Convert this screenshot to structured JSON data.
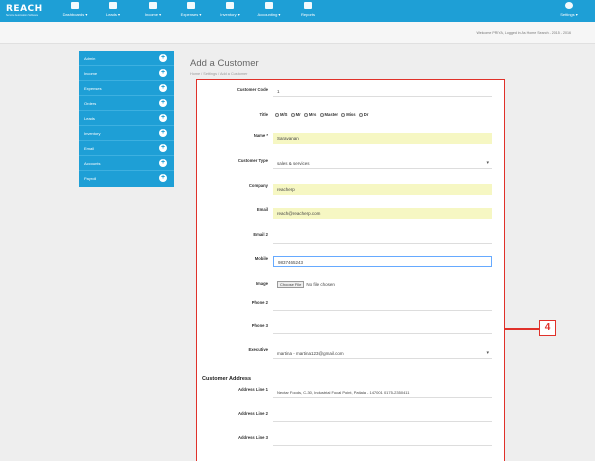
{
  "app": {
    "logo_text": "REACH",
    "logo_sub": "Service Automation Software"
  },
  "nav": {
    "items": [
      {
        "label": "Dashboards ▾",
        "icon": "home-icon"
      },
      {
        "label": "Leads ▾",
        "icon": "list-icon"
      },
      {
        "label": "Income ▾",
        "icon": "chart-icon"
      },
      {
        "label": "Expenses ▾",
        "icon": "money-icon"
      },
      {
        "label": "Inventory ▾",
        "icon": "boxes-icon"
      },
      {
        "label": "Accounting ▾",
        "icon": "book-icon"
      },
      {
        "label": "Reports",
        "icon": "report-icon"
      }
    ],
    "settings_label": "Settings ▾"
  },
  "subheader": {
    "welcome": "Welcome PRIYA, Logged in As Home Search - 2015 - 2016"
  },
  "sidebar": {
    "items": [
      {
        "label": "Admin"
      },
      {
        "label": "Income"
      },
      {
        "label": "Expenses"
      },
      {
        "label": "Orders"
      },
      {
        "label": "Leads"
      },
      {
        "label": "Inventory"
      },
      {
        "label": "Email"
      },
      {
        "label": "Accounts"
      },
      {
        "label": "Payroll"
      }
    ],
    "plus_symbol": "+"
  },
  "page": {
    "title": "Add a Customer",
    "breadcrumb": "Home  /  Settings  /  Add a Customer"
  },
  "form": {
    "customer_code": {
      "label": "Customer Code",
      "value": "1"
    },
    "title": {
      "label": "Title",
      "options": [
        "M/S",
        "Mr",
        "Mrs",
        "Master",
        "Miss",
        "Dr"
      ]
    },
    "name": {
      "label": "Name *",
      "value": "Saravanan"
    },
    "customer_type": {
      "label": "Customer Type",
      "value": "sales & services"
    },
    "company": {
      "label": "Company",
      "value": "reacherp"
    },
    "email": {
      "label": "Email",
      "value": "reach@reacherp.com"
    },
    "email2": {
      "label": "Email 2",
      "value": ""
    },
    "mobile": {
      "label": "Mobile",
      "value": "9837465243"
    },
    "image": {
      "label": "Image",
      "button": "Choose File",
      "status": "No file chosen"
    },
    "phone2": {
      "label": "Phone 2",
      "value": ""
    },
    "phone3": {
      "label": "Phone 3",
      "value": ""
    },
    "executive": {
      "label": "Executive",
      "value": "martina - martina123@gmail.com"
    },
    "address_section": "Customer Address",
    "address1": {
      "label": "Address Line 1",
      "value": "Nectar Foods, C-30, Industrial Focal Point, Patiala - 147001 0175-2350411"
    },
    "address2": {
      "label": "Address Line 2",
      "value": ""
    },
    "address3": {
      "label": "Address Line 3",
      "value": ""
    }
  },
  "callout": {
    "number": "4",
    "color": "#e0312a"
  },
  "colors": {
    "brand": "#1e9fd6",
    "highlight": "#f6f7c3"
  }
}
